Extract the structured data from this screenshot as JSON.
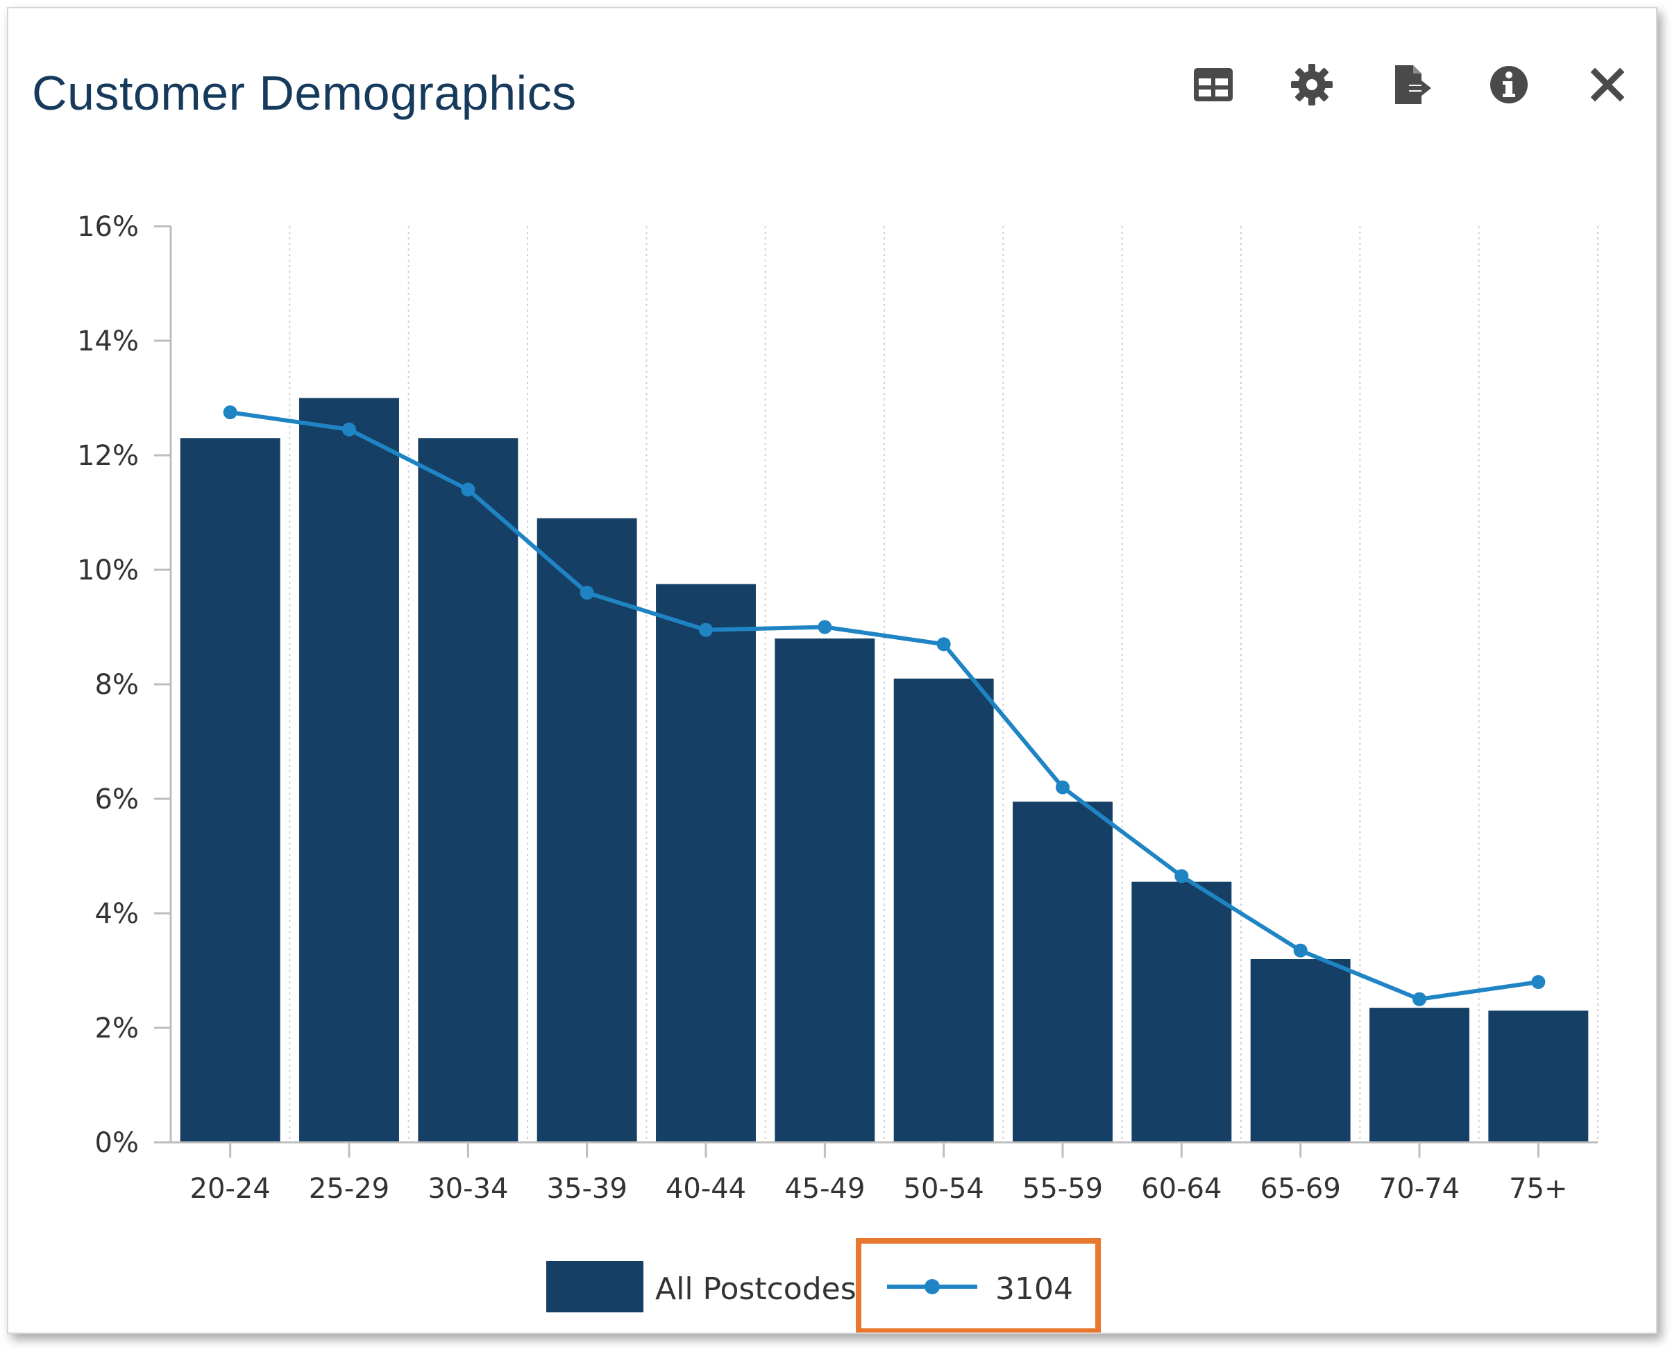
{
  "header": {
    "title": "Customer Demographics",
    "icons": [
      "table-icon",
      "gear-icon",
      "export-icon",
      "info-icon",
      "close-icon"
    ]
  },
  "colors": {
    "bar": "#163f66",
    "line": "#1f84c4",
    "title": "#163a5c",
    "highlight": "#e8782d"
  },
  "chart_data": {
    "type": "bar",
    "title": "",
    "xlabel": "",
    "ylabel": "",
    "categories": [
      "20-24",
      "25-29",
      "30-34",
      "35-39",
      "40-44",
      "45-49",
      "50-54",
      "55-59",
      "60-64",
      "65-69",
      "70-74",
      "75+"
    ],
    "series": [
      {
        "name": "All Postcodes",
        "type": "bar",
        "values": [
          12.3,
          13.0,
          12.3,
          10.9,
          9.75,
          8.8,
          8.1,
          5.95,
          4.55,
          3.2,
          2.35,
          2.3
        ]
      },
      {
        "name": "3104",
        "type": "line",
        "values": [
          12.75,
          12.45,
          11.4,
          9.6,
          8.95,
          9.0,
          8.7,
          6.2,
          4.65,
          3.35,
          2.5,
          2.8
        ]
      }
    ],
    "ylim": [
      0,
      16
    ],
    "yticks": [
      0,
      2,
      4,
      6,
      8,
      10,
      12,
      14,
      16
    ],
    "ytick_format": "%",
    "grid": "vertical dotted",
    "legend": "bottom-center"
  }
}
